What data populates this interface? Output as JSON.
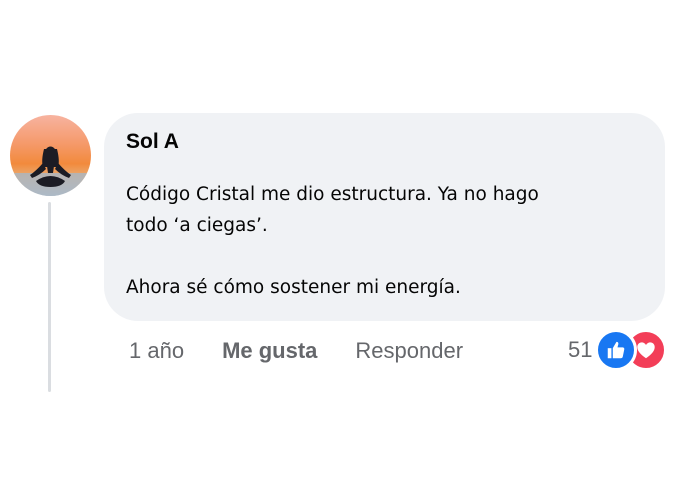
{
  "comment": {
    "author": "Sol A",
    "text_lines": [
      "Código Cristal me dio estructura. Ya no hago",
      "todo ‘a ciegas’."
    ],
    "text_line_2": "Ahora sé cómo sostener mi energía.",
    "avatar_icon": "meditation-silhouette-sunset-avatar"
  },
  "actions": {
    "time": "1 año",
    "like_label": "Me gusta",
    "reply_label": "Responder"
  },
  "reactions": {
    "count": "51",
    "types": [
      "like-icon",
      "love-icon"
    ]
  },
  "colors": {
    "bubble": "#f0f2f5",
    "meta_text": "#65676b",
    "like_blue": "#1877f2",
    "love_red": "#f33e58",
    "thread_line": "#dadde1"
  }
}
